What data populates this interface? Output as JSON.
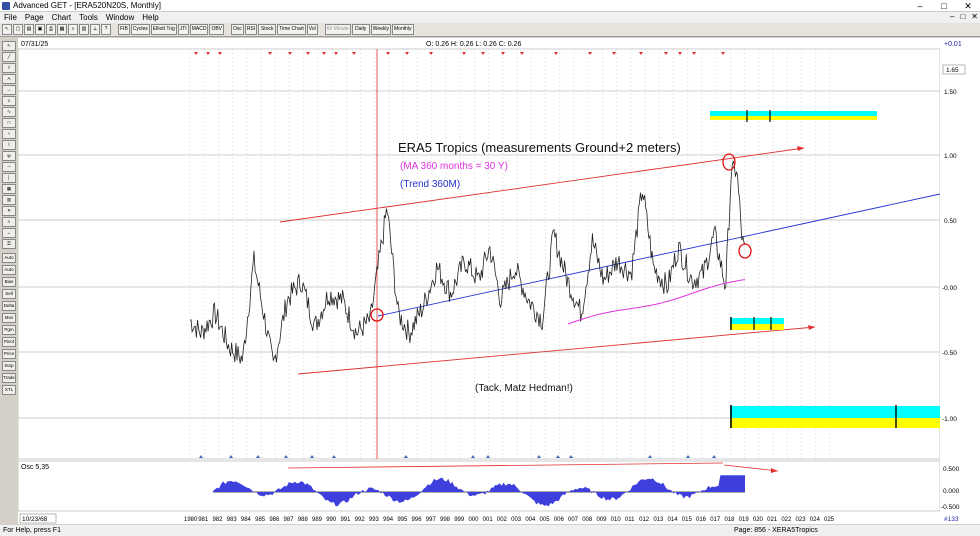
{
  "window": {
    "title": "Advanced GET - [ERA520N20S, Monthly]",
    "controls": [
      "–",
      "□",
      "✕"
    ]
  },
  "menu": [
    "File",
    "Page",
    "Chart",
    "Tools",
    "Window",
    "Help"
  ],
  "toolbar": {
    "buttons": [
      "FIB",
      "Cycles",
      "Elliott Trig",
      "JTI",
      "MACD",
      "OBV",
      "Osc",
      "RSI",
      "Stock",
      "Time Chart",
      "Vol"
    ],
    "period_buttons": [
      "60 Minute",
      "Daily",
      "Weekly",
      "Monthly"
    ]
  },
  "left_tools": [
    "Auto Gann",
    "Auto Trend",
    "Bias",
    "Sell Build",
    "Delta",
    "Mov Ave",
    "Pgm Profit",
    "Pivot",
    "Price Osc",
    "Stop Osc",
    "Trade Profile",
    "XTL"
  ],
  "right_tools": [
    "PTI",
    "U"
  ],
  "header": {
    "date": "07/31/25",
    "ohlc": "O: 0.26  H: 0.26  L: 0.26  C: 0.26",
    "change": "+0.01",
    "last_value": "1.65"
  },
  "annotations": {
    "title": "ERA5 Tropics (measurements Ground+2 meters)",
    "ma": "(MA 360 months = 30 Y)",
    "trend": "(Trend 360M)",
    "credit": "(Tack, Matz Hedman!)"
  },
  "colors": {
    "price": "#222222",
    "ma": "#dd33dd",
    "trend": "#2233cc",
    "channel": "#e03030",
    "osc": "#3333dd",
    "bar_cyan": "#00ffff",
    "bar_yellow": "#ffff00"
  },
  "price_axis": [
    "1.50",
    "1.00",
    "0.50",
    "-0.00",
    "-0.50",
    "-1.00"
  ],
  "osc": {
    "label": "Osc 5,35",
    "axis": [
      "0.500",
      "0.000",
      "-0.500"
    ]
  },
  "time_axis": {
    "start_label": "10/23/68",
    "years": [
      "1980",
      "981",
      "982",
      "983",
      "984",
      "985",
      "986",
      "987",
      "988",
      "989",
      "990",
      "991",
      "992",
      "993",
      "994",
      "995",
      "996",
      "997",
      "998",
      "999",
      "000",
      "001",
      "002",
      "003",
      "004",
      "005",
      "006",
      "007",
      "008",
      "009",
      "010",
      "011",
      "012",
      "013",
      "014",
      "015",
      "016",
      "017",
      "018",
      "019",
      "020",
      "021",
      "022",
      "023",
      "024",
      "025"
    ],
    "bars_shown": "#133"
  },
  "status": {
    "left": "For Help, press F1",
    "right": "Page: 856 - XERA5Tropics"
  }
}
